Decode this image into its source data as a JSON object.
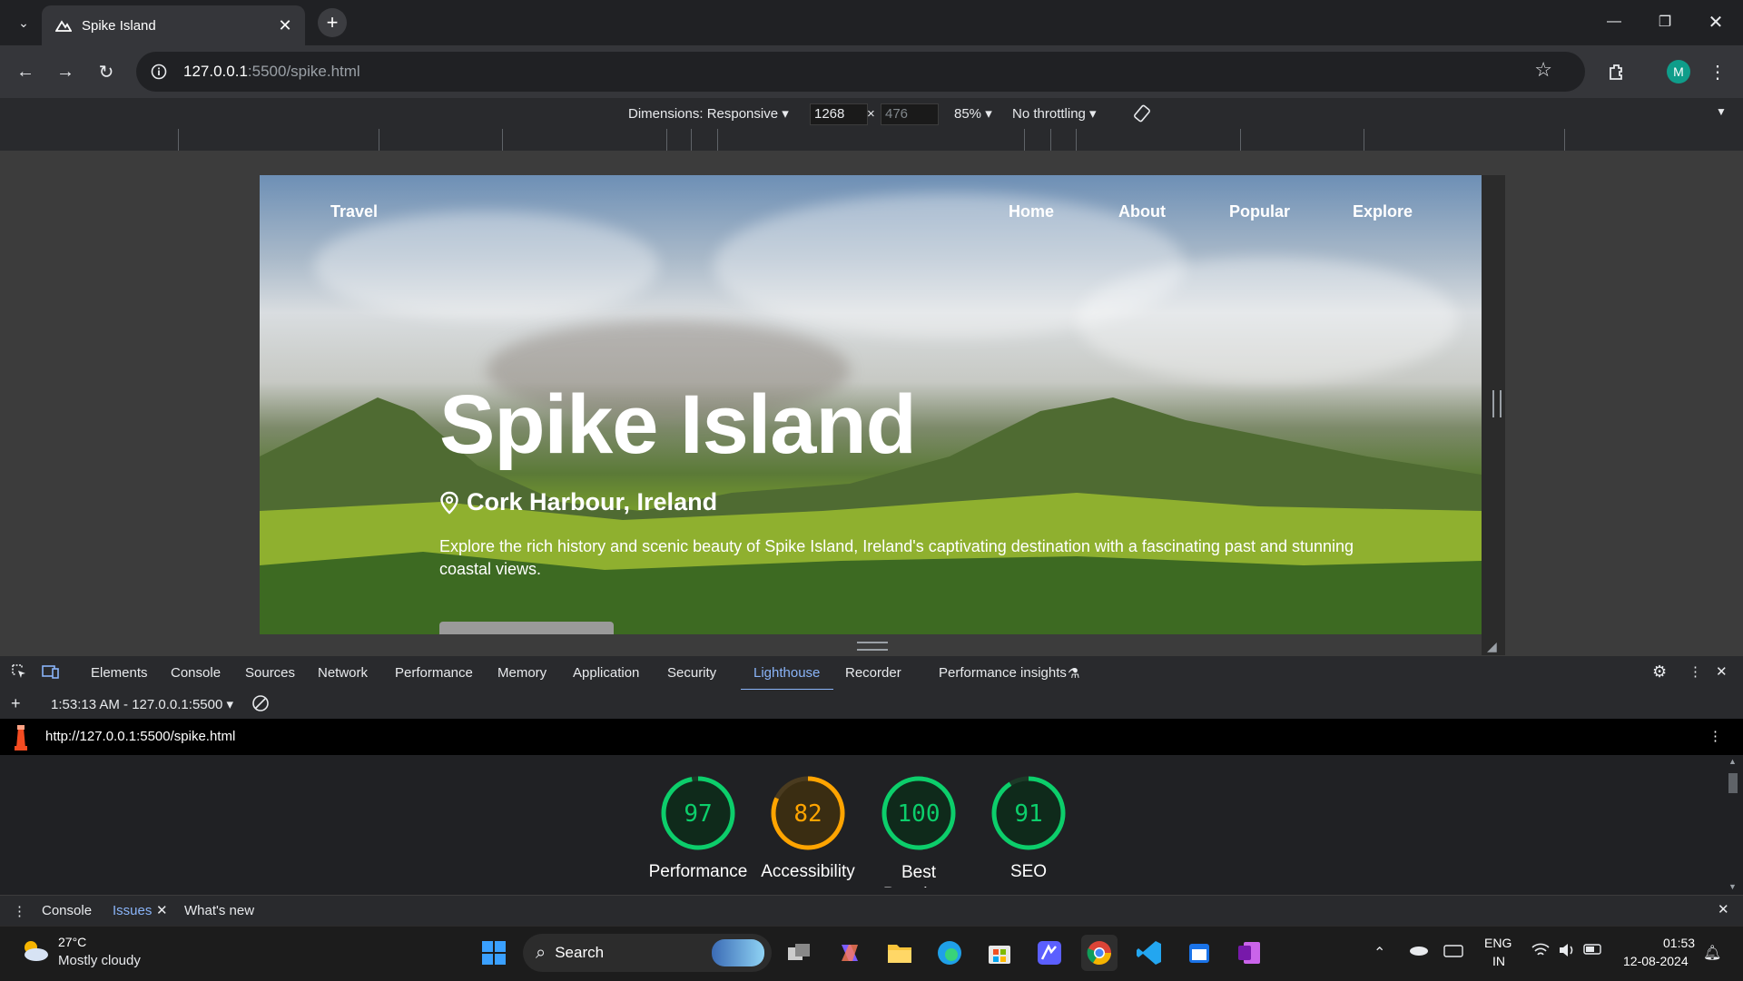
{
  "browser": {
    "tab_title": "Spike Island",
    "url_host": "127.0.0.1",
    "url_rest": ":5500/spike.html",
    "profile_initial": "M"
  },
  "device_toolbar": {
    "dimensions_label": "Dimensions: Responsive",
    "width": "1268",
    "height_placeholder": "476",
    "times": "×",
    "zoom": "85%",
    "throttling": "No throttling"
  },
  "page": {
    "brand": "Travel",
    "nav": [
      "Home",
      "About",
      "Popular",
      "Explore"
    ],
    "hero_title": "Spike Island",
    "location": "Cork Harbour, Ireland",
    "description": "Explore the rich history and scenic beauty of Spike Island, Ireland's captivating destination with a fascinating past and stunning coastal views."
  },
  "devtools": {
    "tabs": [
      "Elements",
      "Console",
      "Sources",
      "Network",
      "Performance",
      "Memory",
      "Application",
      "Security",
      "Lighthouse",
      "Recorder",
      "Performance insights"
    ],
    "active_tab": "Lighthouse",
    "report_selector": "1:53:13 AM - 127.0.0.1:5500",
    "report_url": "http://127.0.0.1:5500/spike.html",
    "scores": [
      {
        "label": "Performance",
        "value": 97,
        "color": "#0cce6b"
      },
      {
        "label": "Accessibility",
        "value": 82,
        "color": "#ffa400"
      },
      {
        "label": "Best Practices",
        "value": 100,
        "color": "#0cce6b"
      },
      {
        "label": "SEO",
        "value": 91,
        "color": "#0cce6b"
      }
    ],
    "drawer_tabs": [
      "Console",
      "Issues",
      "What's new"
    ],
    "drawer_active": "Issues"
  },
  "taskbar": {
    "weather_temp": "27°C",
    "weather_desc": "Mostly cloudy",
    "search_label": "Search",
    "lang_top": "ENG",
    "lang_bottom": "IN",
    "time": "01:53",
    "date": "12-08-2024"
  }
}
